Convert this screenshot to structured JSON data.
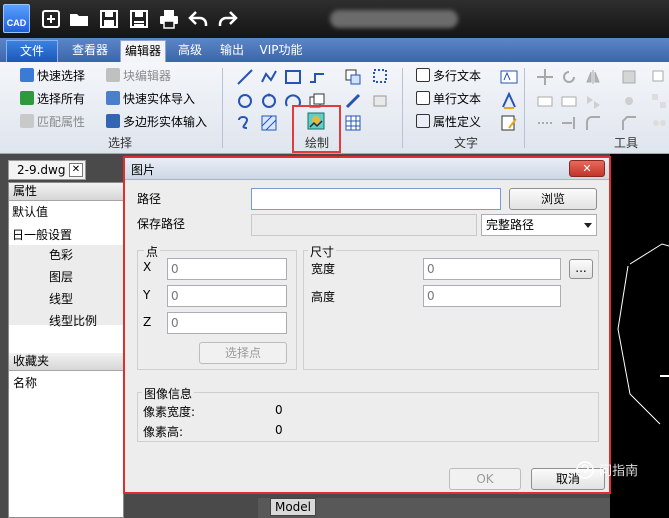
{
  "app": {
    "logo_text": "CAD"
  },
  "tabs": [
    {
      "label": "文件"
    },
    {
      "label": "查看器"
    },
    {
      "label": "编辑器"
    },
    {
      "label": "高级"
    },
    {
      "label": "输出"
    },
    {
      "label": "VIP功能"
    }
  ],
  "ribbon": {
    "select_group": {
      "label": "选择",
      "items": [
        "快速选择",
        "选择所有",
        "匹配属性"
      ],
      "items_right": [
        "块编辑器",
        "快速实体导入",
        "多边形实体输入"
      ]
    },
    "draw_group": {
      "label": "绘制"
    },
    "text_group": {
      "label": "文字",
      "items": [
        "多行文本",
        "单行文本",
        "属性定义"
      ]
    },
    "tools_group": {
      "label": "工具"
    }
  },
  "document": {
    "tab_label": "2-9.dwg",
    "close_label": "✕"
  },
  "properties_panel": {
    "header": "属性",
    "default_value": "默认值",
    "section": "日一般设置",
    "rows": [
      "色彩",
      "图层",
      "线型",
      "线型比例"
    ],
    "favorites_header": "收藏夹",
    "name_label": "名称"
  },
  "dialog": {
    "title": "图片",
    "close_label": "✕",
    "path_label": "路径",
    "path_value": "",
    "browse_label": "浏览",
    "save_path_label": "保存路径",
    "save_path_value": "",
    "path_mode": "完整路径",
    "point_group": {
      "label": "点",
      "x_label": "X",
      "x_value": "0",
      "y_label": "Y",
      "y_value": "0",
      "z_label": "Z",
      "z_value": "0",
      "select_point_label": "选择点"
    },
    "size_group": {
      "label": "尺寸",
      "width_label": "宽度",
      "width_value": "0",
      "height_label": "高度",
      "height_value": "0",
      "more_label": "..."
    },
    "image_info": {
      "label": "图像信息",
      "pixel_width_label": "像素宽度:",
      "pixel_width_value": "0",
      "pixel_height_label": "像素高:",
      "pixel_height_value": "0"
    },
    "ok_label": "OK",
    "cancel_label": "取消"
  },
  "status": {
    "model_tab": "Model"
  },
  "watermark": "问指南"
}
